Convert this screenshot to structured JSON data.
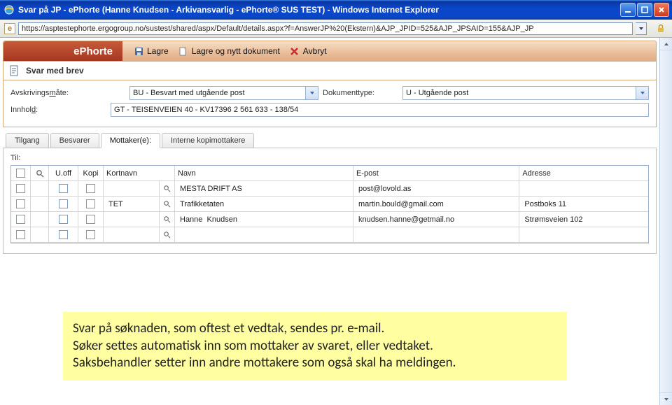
{
  "window": {
    "title": "Svar på JP - ePhorte (Hanne Knudsen - Arkivansvarlig - ePhorte® SUS TEST) - Windows Internet Explorer",
    "url": "https://asptestephorte.ergogroup.no/sustest/shared/aspx/Default/details.aspx?f=AnswerJP%20(Ekstern)&AJP_JPID=525&AJP_JPSAID=155&AJP_JP"
  },
  "brand": "ePhorte",
  "toolbar": {
    "save": "Lagre",
    "save_new": "Lagre og nytt dokument",
    "cancel": "Avbryt"
  },
  "section_title": "Svar med brev",
  "form": {
    "avskriv_label_pre": "Avskrivings",
    "avskriv_label_ul": "m",
    "avskriv_label_post": "åte:",
    "avskriv_value": "BU - Besvart med utgående post",
    "doktype_label": "Dokumenttype:",
    "doktype_value": "U - Utgående post",
    "innhold_label_pre": "Innhol",
    "innhold_label_ul": "d",
    "innhold_label_post": ":",
    "innhold_value": "GT - TEISENVEIEN 40 - KV17396 2 561 633 - 138/54"
  },
  "tabs": {
    "tilgang": "Tilgang",
    "besvarer": "Besvarer",
    "mottaker": "Mottaker(e):",
    "interne": "Interne kopimottakere"
  },
  "grid": {
    "til_label": "Til:",
    "headers": {
      "uoff": "U.off",
      "kopi": "Kopi",
      "kortnavn": "Kortnavn",
      "navn": "Navn",
      "epost": "E-post",
      "adresse": "Adresse"
    },
    "rows": [
      {
        "kortnavn": "",
        "navn": "MESTA DRIFT AS",
        "epost": "post@lovold.as",
        "adresse": ""
      },
      {
        "kortnavn": "TET",
        "navn": "Trafikketaten",
        "epost": "martin.bould@gmail.com",
        "adresse": "Postboks 11"
      },
      {
        "kortnavn": "",
        "navn": "Hanne  Knudsen",
        "epost": "knudsen.hanne@getmail.no",
        "adresse": "Strømsveien 102"
      },
      {
        "kortnavn": "",
        "navn": "",
        "epost": "",
        "adresse": ""
      }
    ]
  },
  "callout": {
    "line1": "Svar på søknaden, som oftest et vedtak, sendes pr. e-mail.",
    "line2": "Søker settes automatisk inn som mottaker av svaret, eller vedtaket.",
    "line3": "Saksbehandler setter inn andre mottakere som også skal ha meldingen."
  }
}
